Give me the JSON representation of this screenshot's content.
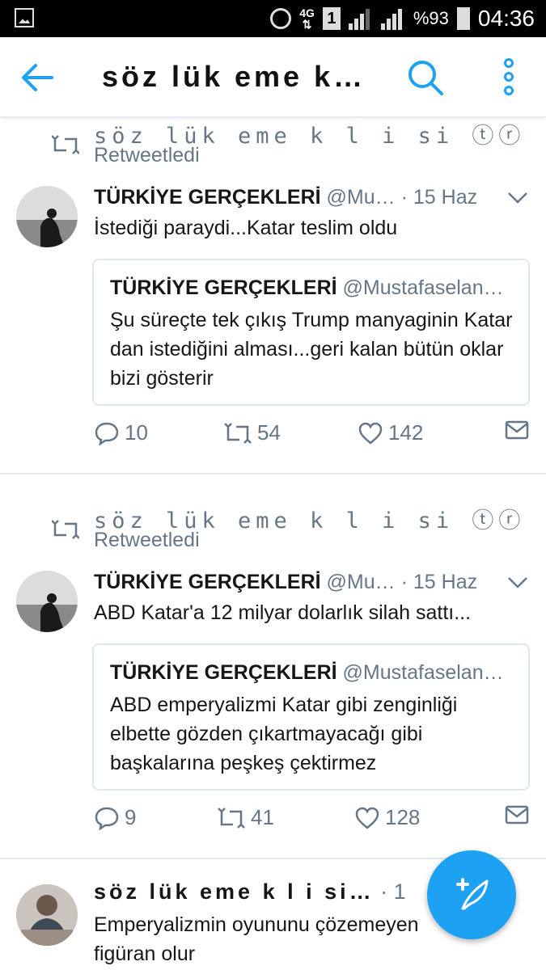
{
  "status_bar": {
    "network": "4G",
    "sim": "1",
    "battery": "%93",
    "time": "04:36"
  },
  "app_bar": {
    "title": "söz lük eme k…"
  },
  "tweets": [
    {
      "retweeted_by": "söz lük eme k l i si ⓣⓡ",
      "retweet_label": "Retweetledi",
      "name": "TÜRKİYE GERÇEKLERİ",
      "handle": "@Mu…",
      "dot": "·",
      "time": "15 Haz",
      "text": "İstediği paraydi...Katar teslim oldu",
      "quote": {
        "name": "TÜRKİYE GERÇEKLERİ",
        "handle": "@Mustafaselan…",
        "text": "Şu süreçte tek çıkış Trump manyaginin Katar dan istediğini alması...geri kalan bütün oklar bizi gösterir"
      },
      "replies": "10",
      "retweets": "54",
      "likes": "142"
    },
    {
      "retweeted_by": "söz lük eme k l i si ⓣⓡ",
      "retweet_label": "Retweetledi",
      "name": "TÜRKİYE GERÇEKLERİ",
      "handle": "@Mu…",
      "dot": "·",
      "time": "15 Haz",
      "text": "ABD Katar'a 12 milyar dolarlık silah sattı...",
      "quote": {
        "name": "TÜRKİYE GERÇEKLERİ",
        "handle": "@Mustafaselan…",
        "text": "ABD emperyalizmi Katar gibi zenginliği elbette gözden çıkartmayacağı gibi başkalarına peşkeş çektirmez"
      },
      "replies": "9",
      "retweets": "41",
      "likes": "128"
    },
    {
      "name": "söz lük eme k l i si…",
      "dot": "·",
      "time": "1",
      "text_line1": "Emperyalizmin oyununu çözemeyen",
      "text_line2": "figüran olur"
    }
  ],
  "colors": {
    "accent": "#1da1f2",
    "muted": "#657786",
    "border": "#e1e8ed"
  },
  "icons": [
    "back-arrow-icon",
    "search-icon",
    "more-vertical-icon",
    "retweet-icon",
    "chevron-down-icon",
    "reply-icon",
    "heart-icon",
    "direct-message-icon",
    "compose-icon"
  ]
}
